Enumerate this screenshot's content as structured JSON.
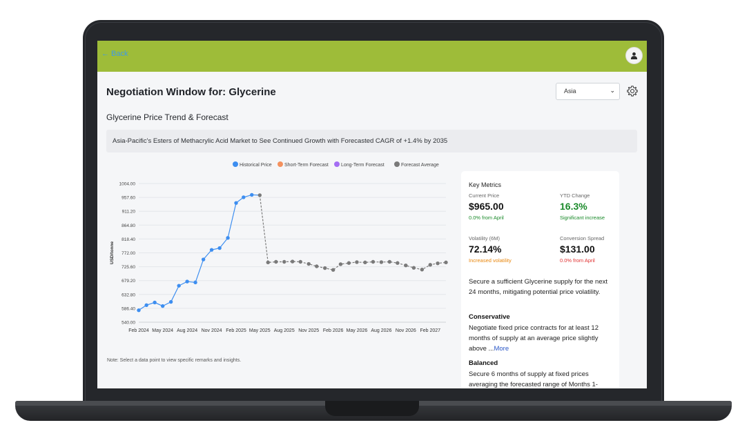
{
  "header": {
    "back_label": "← Back"
  },
  "page": {
    "title": "Negotiation Window for: Glycerine",
    "region_selected": "Asia",
    "section_title": "Glycerine Price Trend & Forecast",
    "headline": "Asia-Pacific's Esters of Methacrylic Acid Market to See Continued Growth with Forecasted CAGR of +1.4% by 2035"
  },
  "colors": {
    "topbar": "#9ebc39",
    "historical": "#3d8ef0",
    "short_term": "#f4915e",
    "long_term": "#a46ef3",
    "forecast_avg": "#7a7a7a",
    "positive": "#1a8a2a",
    "negative": "#e03131",
    "warning": "#e8860c"
  },
  "chart_data": {
    "type": "line",
    "ylabel": "USD/tonne",
    "ylim": [
      540,
      1004
    ],
    "y_ticks": [
      "1004.00",
      "957.60",
      "911.20",
      "864.80",
      "818.40",
      "772.00",
      "725.60",
      "679.20",
      "632.80",
      "586.40",
      "540.00"
    ],
    "x_ticks": [
      "Feb 2024",
      "May 2024",
      "Aug 2024",
      "Nov 2024",
      "Feb 2025",
      "May 2025",
      "Aug 2025",
      "Nov 2025",
      "Feb 2026",
      "May 2026",
      "Aug 2026",
      "Nov 2026",
      "Feb 2027"
    ],
    "legend": [
      "Historical Price",
      "Short-Term Forecast",
      "Long-Term Forecast",
      "Forecast Average"
    ],
    "series": [
      {
        "name": "Historical Price",
        "x": [
          "2024-02",
          "2024-03",
          "2024-04",
          "2024-05",
          "2024-06",
          "2024-07",
          "2024-08",
          "2024-09",
          "2024-10",
          "2024-11",
          "2024-12",
          "2025-01",
          "2025-02",
          "2025-03",
          "2025-04",
          "2025-05"
        ],
        "values": [
          580,
          597,
          606,
          594,
          608,
          662,
          676,
          673,
          750,
          782,
          788,
          822,
          939,
          958,
          966,
          965
        ]
      },
      {
        "name": "Forecast Average",
        "x": [
          "2025-05",
          "2025-06",
          "2025-07",
          "2025-08",
          "2025-09",
          "2025-10",
          "2025-11",
          "2025-12",
          "2026-01",
          "2026-02",
          "2026-03",
          "2026-04",
          "2026-05",
          "2026-06",
          "2026-07",
          "2026-08",
          "2026-09",
          "2026-10",
          "2026-11",
          "2026-12",
          "2027-01",
          "2027-02",
          "2027-03",
          "2027-04"
        ],
        "values": [
          965,
          740,
          742,
          742,
          743,
          742,
          735,
          727,
          721,
          715,
          734,
          738,
          741,
          740,
          742,
          741,
          742,
          738,
          730,
          722,
          716,
          732,
          737,
          740
        ]
      }
    ]
  },
  "chart_note": "Note: Select a data point to view specific remarks and insights.",
  "metrics": {
    "heading": "Key Metrics",
    "current_price": {
      "label": "Current Price",
      "value": "$965.00",
      "sub": "0.0% from April"
    },
    "ytd_change": {
      "label": "YTD Change",
      "value": "16.3%",
      "sub": "Significant increase"
    },
    "volatility": {
      "label": "Volatility (6M)",
      "value": "72.14%",
      "sub": "Increased volatility"
    },
    "conversion_spread": {
      "label": "Conversion Spread",
      "value": "$131.00",
      "sub": "0.0% from April"
    },
    "summary": "Secure a sufficient Glycerine supply for the next 24 months, mitigating potential price volatility.",
    "conservative_title": "Conservative",
    "conservative_text": "Negotiate fixed price contracts for at least 12 months of supply at an average price slightly above ...",
    "more_label": "More",
    "balanced_title": "Balanced",
    "balanced_text": "Secure 6 months of supply at fixed prices averaging the forecasted range of Months 1-"
  }
}
